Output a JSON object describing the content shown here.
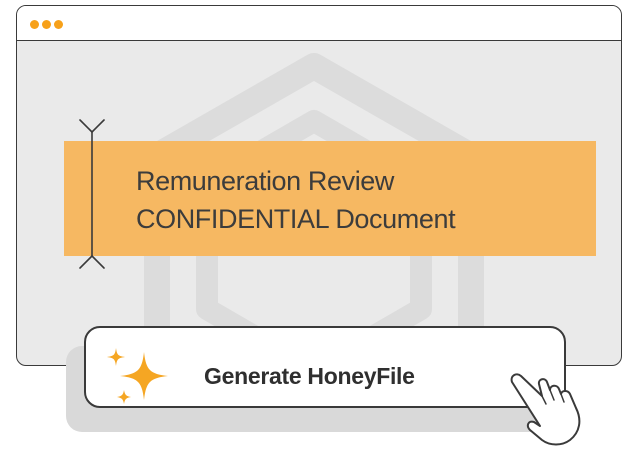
{
  "window": {
    "controls": [
      "close-dot",
      "minimize-dot",
      "maximize-dot"
    ],
    "control_color": "#f7a11a"
  },
  "banner": {
    "line1": "Remuneration Review",
    "line2": "CONFIDENTIAL Document",
    "color": "#f6b862"
  },
  "cta": {
    "label": "Generate HoneyFile",
    "icon": "sparkle-icon",
    "pointer_icon": "hand-pointer-icon",
    "accent": "#f5a623"
  }
}
